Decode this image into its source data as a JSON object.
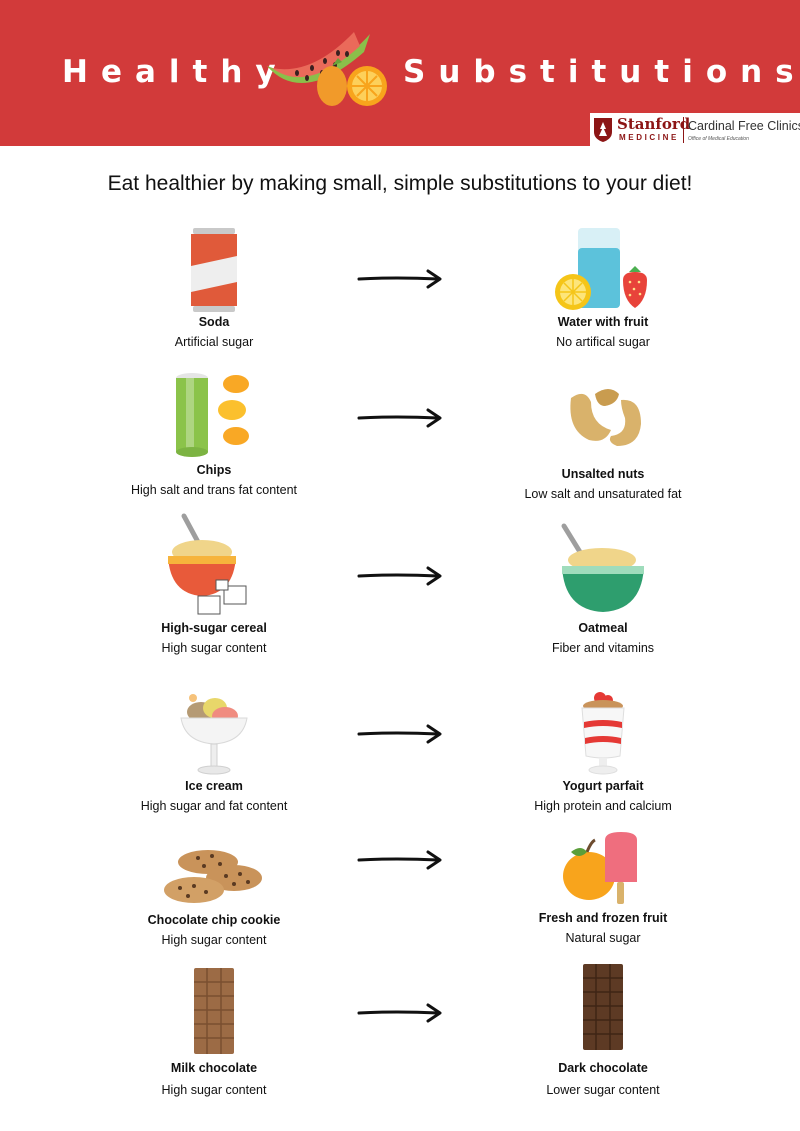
{
  "header": {
    "title_left": "Healthy",
    "title_right": "Substitutions",
    "logo_stanford": "Stanford",
    "logo_medicine": "MEDICINE",
    "logo_clinic": "Cardinal Free Clinics",
    "logo_office": "Office of Medical Education"
  },
  "intro": "Eat healthier by making small, simple substitutions to your diet!",
  "colors": {
    "banner": "#d23a3a",
    "stanford_red": "#8c1515"
  },
  "rows": [
    {
      "from": {
        "name": "Soda",
        "desc": "Artificial sugar",
        "icon": "soda-can-icon"
      },
      "to": {
        "name": "Water with fruit",
        "desc": "No artifical sugar",
        "icon": "water-fruit-icon"
      }
    },
    {
      "from": {
        "name": "Chips",
        "desc": "High salt and trans fat content",
        "icon": "chips-icon"
      },
      "to": {
        "name": "Unsalted nuts",
        "desc": "Low salt and unsaturated fat",
        "icon": "cashew-nuts-icon"
      }
    },
    {
      "from": {
        "name": "High-sugar cereal",
        "desc": "High sugar content",
        "icon": "cereal-bowl-icon"
      },
      "to": {
        "name": "Oatmeal",
        "desc": "Fiber and vitamins",
        "icon": "oatmeal-bowl-icon"
      }
    },
    {
      "from": {
        "name": "Ice cream",
        "desc": "High sugar and fat content",
        "icon": "ice-cream-cup-icon"
      },
      "to": {
        "name": "Yogurt parfait",
        "desc": "High protein and calcium",
        "icon": "yogurt-parfait-icon"
      }
    },
    {
      "from": {
        "name": "Chocolate chip cookie",
        "desc": "High sugar content",
        "icon": "cookies-icon"
      },
      "to": {
        "name": "Fresh and frozen fruit",
        "desc": "Natural sugar",
        "icon": "fruit-popsicle-icon"
      }
    },
    {
      "from": {
        "name": "Milk chocolate",
        "desc": "High sugar content",
        "icon": "milk-chocolate-icon"
      },
      "to": {
        "name": "Dark chocolate",
        "desc": "Lower sugar content",
        "icon": "dark-chocolate-icon"
      }
    }
  ]
}
